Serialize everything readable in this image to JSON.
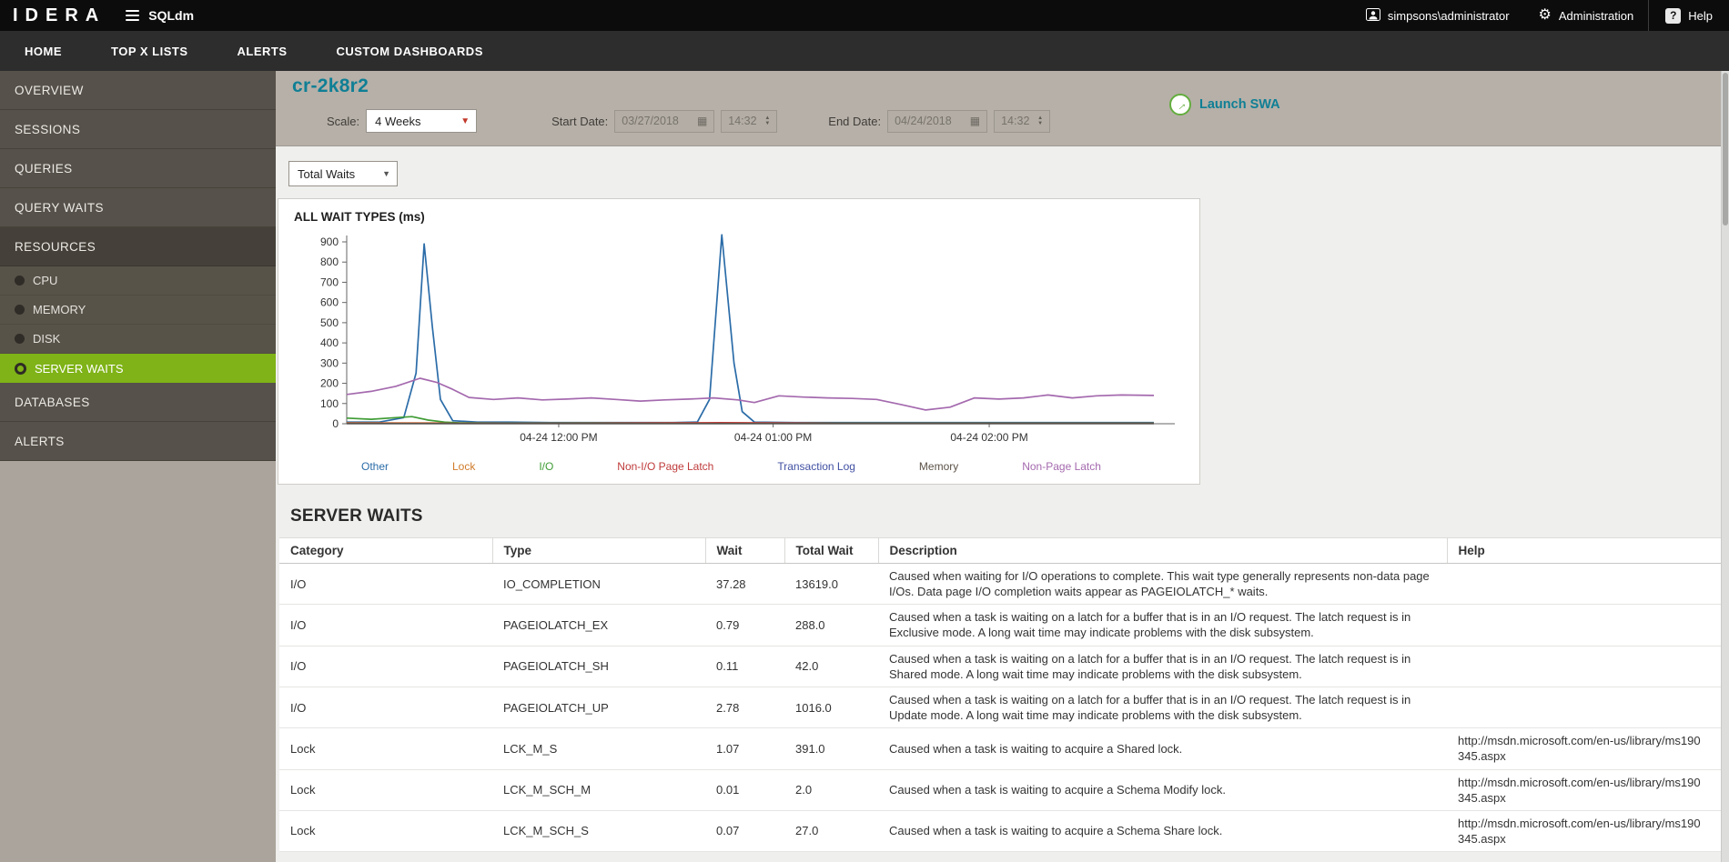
{
  "colors": {
    "accent_teal": "#0f7f95",
    "active_green": "#7fb317",
    "topbar_bg": "#0c0c0c",
    "band_bg": "#b6b0a8"
  },
  "topbar": {
    "brand": "IDERA",
    "product": "SQLdm",
    "user": "simpsons\\administrator",
    "admin_label": "Administration",
    "help_label": "Help"
  },
  "nav": {
    "items": [
      {
        "label": "HOME"
      },
      {
        "label": "TOP X LISTS"
      },
      {
        "label": "ALERTS"
      },
      {
        "label": "CUSTOM DASHBOARDS"
      }
    ]
  },
  "sidebar": {
    "items": [
      {
        "label": "OVERVIEW",
        "type": "item"
      },
      {
        "label": "SESSIONS",
        "type": "item"
      },
      {
        "label": "QUERIES",
        "type": "item"
      },
      {
        "label": "QUERY WAITS",
        "type": "item"
      },
      {
        "label": "RESOURCES",
        "type": "section"
      },
      {
        "label": "CPU",
        "type": "sub"
      },
      {
        "label": "MEMORY",
        "type": "sub"
      },
      {
        "label": "DISK",
        "type": "sub"
      },
      {
        "label": "SERVER WAITS",
        "type": "sub",
        "active": true
      },
      {
        "label": "DATABASES",
        "type": "item"
      },
      {
        "label": "ALERTS",
        "type": "item"
      }
    ]
  },
  "header": {
    "server_name": "cr-2k8r2",
    "scale_label": "Scale:",
    "scale_value": "4 Weeks",
    "start_date_label": "Start Date:",
    "start_date": "03/27/2018",
    "start_time": "14:32",
    "end_date_label": "End Date:",
    "end_date": "04/24/2018",
    "end_time": "14:32",
    "launch_swa": "Launch SWA"
  },
  "waits_view": {
    "selector_value": "Total Waits"
  },
  "chart_data": {
    "type": "line",
    "title": "ALL WAIT TYPES (ms)",
    "ylim": [
      0,
      900
    ],
    "ytick_interval": 100,
    "grid": false,
    "legend_position": "bottom",
    "x_ticks": [
      {
        "pos": 26,
        "label": "04-24 12:00 PM"
      },
      {
        "pos": 52.3,
        "label": "04-24 01:00 PM"
      },
      {
        "pos": 78.8,
        "label": "04-24 02:00 PM"
      }
    ],
    "series": [
      {
        "name": "Other",
        "color": "#2b6ca8",
        "points": [
          [
            0,
            8
          ],
          [
            4,
            8
          ],
          [
            7,
            30
          ],
          [
            8.5,
            250
          ],
          [
            9.5,
            890
          ],
          [
            10.5,
            480
          ],
          [
            11.5,
            120
          ],
          [
            13,
            15
          ],
          [
            16,
            8
          ],
          [
            20,
            8
          ],
          [
            25,
            6
          ],
          [
            30,
            6
          ],
          [
            35,
            6
          ],
          [
            40,
            6
          ],
          [
            43,
            8
          ],
          [
            44.5,
            120
          ],
          [
            46,
            935
          ],
          [
            47.5,
            300
          ],
          [
            48.5,
            60
          ],
          [
            50,
            8
          ],
          [
            55,
            6
          ],
          [
            60,
            6
          ],
          [
            65,
            6
          ],
          [
            70,
            6
          ],
          [
            75,
            6
          ],
          [
            80,
            6
          ],
          [
            85,
            6
          ],
          [
            90,
            6
          ],
          [
            95,
            6
          ],
          [
            99,
            6
          ]
        ]
      },
      {
        "name": "Lock",
        "color": "#d07b2a",
        "points": [
          [
            0,
            4
          ],
          [
            20,
            3
          ],
          [
            40,
            4
          ],
          [
            60,
            3
          ],
          [
            80,
            3
          ],
          [
            99,
            3
          ]
        ]
      },
      {
        "name": "I/O",
        "color": "#3f9c35",
        "points": [
          [
            0,
            28
          ],
          [
            3,
            22
          ],
          [
            6,
            30
          ],
          [
            8,
            35
          ],
          [
            10,
            18
          ],
          [
            12,
            8
          ],
          [
            14,
            4
          ],
          [
            18,
            3
          ],
          [
            25,
            3
          ],
          [
            35,
            3
          ],
          [
            45,
            3
          ],
          [
            55,
            3
          ],
          [
            65,
            3
          ],
          [
            75,
            3
          ],
          [
            85,
            3
          ],
          [
            95,
            3
          ],
          [
            99,
            3
          ]
        ]
      },
      {
        "name": "Non-I/O Page Latch",
        "color": "#bf3a3a",
        "points": [
          [
            0,
            2
          ],
          [
            30,
            2
          ],
          [
            46,
            5
          ],
          [
            60,
            2
          ],
          [
            99,
            2
          ]
        ]
      },
      {
        "name": "Transaction Log",
        "color": "#4150a2",
        "points": [
          [
            0,
            1
          ],
          [
            50,
            1
          ],
          [
            99,
            1
          ]
        ]
      },
      {
        "name": "Memory",
        "color": "#5c5248",
        "points": [
          [
            0,
            1
          ],
          [
            50,
            1
          ],
          [
            99,
            1
          ]
        ]
      },
      {
        "name": "Non-Page Latch",
        "color": "#a469ae",
        "points": [
          [
            0,
            145
          ],
          [
            3,
            160
          ],
          [
            6,
            185
          ],
          [
            9,
            225
          ],
          [
            11,
            205
          ],
          [
            13,
            170
          ],
          [
            15,
            130
          ],
          [
            18,
            120
          ],
          [
            21,
            128
          ],
          [
            24,
            118
          ],
          [
            27,
            122
          ],
          [
            30,
            128
          ],
          [
            33,
            120
          ],
          [
            36,
            112
          ],
          [
            39,
            118
          ],
          [
            42,
            122
          ],
          [
            45,
            128
          ],
          [
            48,
            118
          ],
          [
            50,
            105
          ],
          [
            53,
            138
          ],
          [
            56,
            132
          ],
          [
            59,
            128
          ],
          [
            62,
            125
          ],
          [
            65,
            120
          ],
          [
            68,
            95
          ],
          [
            71,
            68
          ],
          [
            74,
            82
          ],
          [
            77,
            128
          ],
          [
            80,
            122
          ],
          [
            83,
            128
          ],
          [
            86,
            142
          ],
          [
            89,
            128
          ],
          [
            92,
            138
          ],
          [
            95,
            142
          ],
          [
            99,
            140
          ]
        ]
      }
    ]
  },
  "server_waits": {
    "title": "SERVER WAITS",
    "columns": [
      "Category",
      "Type",
      "Wait",
      "Total Wait",
      "Description",
      "Help"
    ],
    "rows": [
      {
        "category": "I/O",
        "type": "IO_COMPLETION",
        "wait": "37.28",
        "total_wait": "13619.0",
        "description": "Caused when waiting for I/O operations to complete. This wait type generally represents non-data page I/Os. Data page I/O completion waits appear as PAGEIOLATCH_* waits.",
        "help": ""
      },
      {
        "category": "I/O",
        "type": "PAGEIOLATCH_EX",
        "wait": "0.79",
        "total_wait": "288.0",
        "description": "Caused when a task is waiting on a latch for a buffer that is in an I/O request. The latch request is in Exclusive mode. A long wait time may indicate problems with the disk subsystem.",
        "help": ""
      },
      {
        "category": "I/O",
        "type": "PAGEIOLATCH_SH",
        "wait": "0.11",
        "total_wait": "42.0",
        "description": "Caused when a task is waiting on a latch for a buffer that is in an I/O request. The latch request is in Shared mode. A long wait time may indicate problems with the disk subsystem.",
        "help": ""
      },
      {
        "category": "I/O",
        "type": "PAGEIOLATCH_UP",
        "wait": "2.78",
        "total_wait": "1016.0",
        "description": "Caused when a task is waiting on a latch for a buffer that is in an I/O request. The latch request is in Update mode. A long wait time may indicate problems with the disk subsystem.",
        "help": ""
      },
      {
        "category": "Lock",
        "type": "LCK_M_S",
        "wait": "1.07",
        "total_wait": "391.0",
        "description": "Caused when a task is waiting to acquire a Shared lock.",
        "help": "http://msdn.microsoft.com/en-us/library/ms190345.aspx"
      },
      {
        "category": "Lock",
        "type": "LCK_M_SCH_M",
        "wait": "0.01",
        "total_wait": "2.0",
        "description": "Caused when a task is waiting to acquire a Schema Modify lock.",
        "help": "http://msdn.microsoft.com/en-us/library/ms190345.aspx"
      },
      {
        "category": "Lock",
        "type": "LCK_M_SCH_S",
        "wait": "0.07",
        "total_wait": "27.0",
        "description": "Caused when a task is waiting to acquire a Schema Share lock.",
        "help": "http://msdn.microsoft.com/en-us/library/ms190345.aspx"
      }
    ]
  }
}
